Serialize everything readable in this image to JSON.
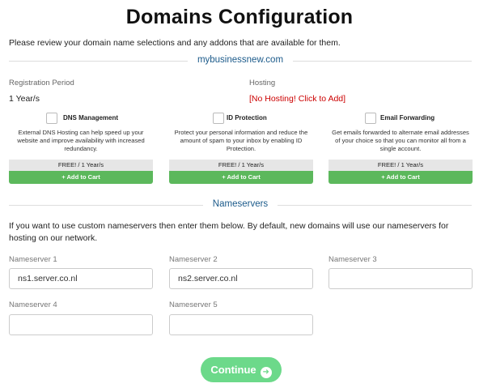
{
  "page": {
    "title": "Domains Configuration",
    "intro": "Please review your domain name selections and any addons that are available for them."
  },
  "domain": {
    "name": "mybusinessnew.com",
    "registration_label": "Registration Period",
    "registration_value": "1 Year/s",
    "hosting_label": "Hosting",
    "hosting_value": "[No Hosting! Click to Add]"
  },
  "addons": [
    {
      "name": "DNS Management",
      "description": "External DNS Hosting can help speed up your website and improve availability with increased redundancy.",
      "price": "FREE! / 1 Year/s",
      "button": "+ Add to Cart",
      "checked": false
    },
    {
      "name": "ID Protection",
      "description": "Protect your personal information and reduce the amount of spam to your inbox by enabling ID Protection.",
      "price": "FREE! / 1 Year/s",
      "button": "+ Add to Cart",
      "checked": false
    },
    {
      "name": "Email Forwarding",
      "description": "Get emails forwarded to alternate email addresses of your choice so that you can monitor all from a single account.",
      "price": "FREE! / 1 Year/s",
      "button": "+ Add to Cart",
      "checked": false
    }
  ],
  "nameservers": {
    "heading": "Nameservers",
    "intro": "If you want to use custom nameservers then enter them below. By default, new domains will use our nameservers for hosting on our network.",
    "fields": [
      {
        "label": "Nameserver 1",
        "value": "ns1.server.co.nl"
      },
      {
        "label": "Nameserver 2",
        "value": "ns2.server.co.nl"
      },
      {
        "label": "Nameserver 3",
        "value": ""
      },
      {
        "label": "Nameserver 4",
        "value": ""
      },
      {
        "label": "Nameserver 5",
        "value": ""
      }
    ]
  },
  "actions": {
    "continue_label": "Continue",
    "continue_icon": "arrow-circle-right-icon"
  },
  "colors": {
    "heading_blue": "#1b5a8a",
    "hosting_red": "#cc0000",
    "cart_green": "#5cb85c",
    "continue_green": "#6cd98a"
  }
}
